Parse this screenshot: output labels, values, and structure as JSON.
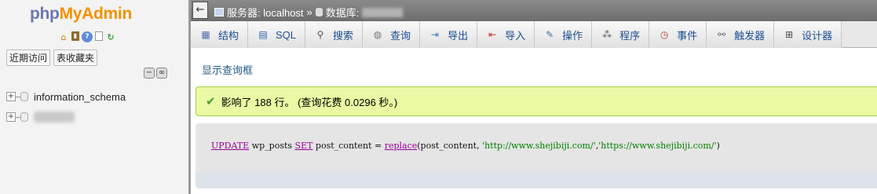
{
  "nav": {
    "logo_php": "php",
    "logo_myadmin": "MyAdmin",
    "icons": [
      "home-icon",
      "exit-icon",
      "help-icon",
      "docs-icon",
      "refresh-icon"
    ],
    "tabs": {
      "recent": "近期访问",
      "favorites": "表收藏夹"
    },
    "collapse_all": "−",
    "link_with_main": "∞",
    "databases": [
      {
        "label": "information_schema",
        "expander": "+"
      },
      {
        "label": "",
        "expander": "+",
        "obscured": true
      }
    ]
  },
  "topbar": {
    "back": "←",
    "server_label": "服务器: localhost",
    "separator": "»",
    "database_label": "数据库:"
  },
  "tabs": [
    {
      "label": "结构",
      "icon": "structure-icon"
    },
    {
      "label": "SQL",
      "icon": "sql-icon"
    },
    {
      "label": "搜索",
      "icon": "search-icon"
    },
    {
      "label": "查询",
      "icon": "query-icon"
    },
    {
      "label": "导出",
      "icon": "export-icon"
    },
    {
      "label": "导入",
      "icon": "import-icon"
    },
    {
      "label": "操作",
      "icon": "wrench-icon"
    },
    {
      "label": "程序",
      "icon": "routines-icon"
    },
    {
      "label": "事件",
      "icon": "clock-icon"
    },
    {
      "label": "触发器",
      "icon": "trigger-icon"
    },
    {
      "label": "设计器",
      "icon": "designer-icon"
    }
  ],
  "main": {
    "show_query_box": "显示查询框",
    "success_message": "影响了 188 行。 (查询花费 0.0296 秒。)",
    "sql": {
      "kw_update": "UPDATE",
      "table": " wp_posts ",
      "kw_set": "SET",
      "assign": " post_content = ",
      "fn_replace": "replace",
      "args_open": "(post_content, ",
      "str_old": "'http://www.shejibiji.com/'",
      "comma": ",",
      "str_new": "'https://www.shejibiji.com/'",
      "args_close": ")"
    }
  },
  "colors": {
    "success_bg": "#ebf8a4",
    "success_border": "#a2d246",
    "link": "#235a81",
    "keyword": "#990099",
    "string": "#008000"
  }
}
